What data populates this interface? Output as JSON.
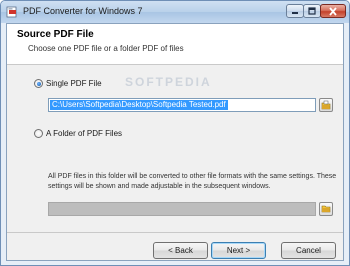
{
  "window": {
    "title": "PDF Converter for Windows 7"
  },
  "header": {
    "title": "Source PDF File",
    "subtitle": "Choose one PDF file or a folder PDF of files"
  },
  "options": {
    "single_label": "Single PDF File",
    "single_selected": true,
    "single_path": "C:\\Users\\Softpedia\\Desktop\\Softpedia Tested.pdf",
    "folder_label": "A Folder of PDF Files",
    "folder_selected": false,
    "folder_path": "",
    "folder_info": "All PDF files in this folder will be converted to other file formats with the same settings. These settings will be shown and made adjustable in the subsequent windows."
  },
  "watermark": "SOFTPEDIA",
  "buttons": {
    "back": "< Back",
    "next": "Next >",
    "cancel": "Cancel"
  },
  "colors": {
    "selection": "#3399ff",
    "title_bar": "#b9d1ea",
    "close_button": "#c4412a"
  },
  "icons": {
    "app": "pdf-converter-icon",
    "browse_file": "open-file-icon",
    "browse_folder": "folder-icon"
  }
}
